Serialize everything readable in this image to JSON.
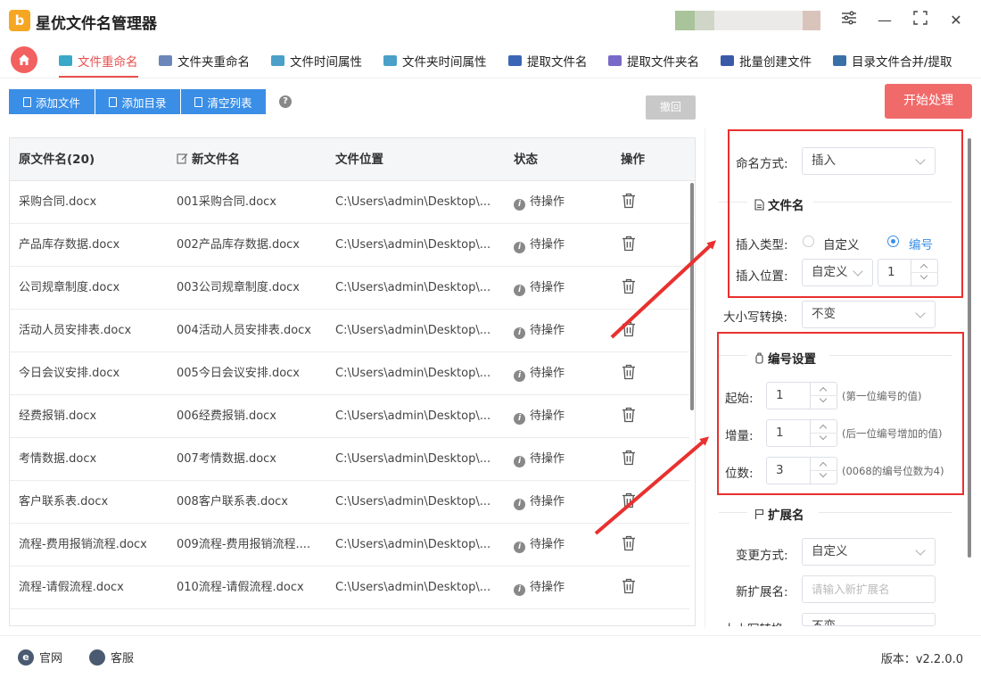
{
  "app": {
    "logo_text": "b",
    "title": "星优文件名管理器"
  },
  "window_controls": {
    "settings_icon": "sliders-icon",
    "minimize": "—",
    "maximize": "⛶",
    "close": "✕"
  },
  "tabs": [
    {
      "label": "文件重命名",
      "active": true,
      "color": "#3aa8c8"
    },
    {
      "label": "文件夹重命名",
      "color": "#6b86b8"
    },
    {
      "label": "文件时间属性",
      "color": "#4aa0c8"
    },
    {
      "label": "文件夹时间属性",
      "color": "#4aa0c8"
    },
    {
      "label": "提取文件名",
      "color": "#3b66b8"
    },
    {
      "label": "提取文件夹名",
      "color": "#7a6ac8"
    },
    {
      "label": "批量创建文件",
      "color": "#3a5aa8"
    },
    {
      "label": "目录文件合并/提取",
      "color": "#3a70a8"
    }
  ],
  "toolbar": {
    "add_file": "添加文件",
    "add_dir": "添加目录",
    "clear_list": "清空列表",
    "help": "?",
    "undo": "撤回",
    "start": "开始处理"
  },
  "table": {
    "headers": {
      "original": "原文件名(20)",
      "new": "新文件名",
      "location": "文件位置",
      "status": "状态",
      "action": "操作"
    },
    "rows": [
      {
        "original": "采购合同.docx",
        "new": "001采购合同.docx",
        "location": "C:\\Users\\admin\\Desktop\\...",
        "status": "待操作"
      },
      {
        "original": "产品库存数据.docx",
        "new": "002产品库存数据.docx",
        "location": "C:\\Users\\admin\\Desktop\\...",
        "status": "待操作"
      },
      {
        "original": "公司规章制度.docx",
        "new": "003公司规章制度.docx",
        "location": "C:\\Users\\admin\\Desktop\\...",
        "status": "待操作"
      },
      {
        "original": "活动人员安排表.docx",
        "new": "004活动人员安排表.docx",
        "location": "C:\\Users\\admin\\Desktop\\...",
        "status": "待操作"
      },
      {
        "original": "今日会议安排.docx",
        "new": "005今日会议安排.docx",
        "location": "C:\\Users\\admin\\Desktop\\...",
        "status": "待操作"
      },
      {
        "original": "经费报销.docx",
        "new": "006经费报销.docx",
        "location": "C:\\Users\\admin\\Desktop\\...",
        "status": "待操作"
      },
      {
        "original": "考情数据.docx",
        "new": "007考情数据.docx",
        "location": "C:\\Users\\admin\\Desktop\\...",
        "status": "待操作"
      },
      {
        "original": "客户联系表.docx",
        "new": "008客户联系表.docx",
        "location": "C:\\Users\\admin\\Desktop\\...",
        "status": "待操作"
      },
      {
        "original": "流程-费用报销流程.docx",
        "new": "009流程-费用报销流程....",
        "location": "C:\\Users\\admin\\Desktop\\...",
        "status": "待操作"
      },
      {
        "original": "流程-请假流程.docx",
        "new": "010流程-请假流程.docx",
        "location": "C:\\Users\\admin\\Desktop\\...",
        "status": "待操作"
      }
    ]
  },
  "settings": {
    "naming_mode_label": "命名方式:",
    "naming_mode_value": "插入",
    "filename_section": "文件名",
    "insert_type_label": "插入类型:",
    "insert_type_options": [
      "自定义",
      "编号"
    ],
    "insert_type_selected": "编号",
    "insert_pos_label": "插入位置:",
    "insert_pos_value": "自定义",
    "insert_pos_number": "1",
    "case_label": "大小写转换:",
    "case_value": "不变",
    "numbering_section": "编号设置",
    "start_label": "起始:",
    "start_value": "1",
    "start_hint": "(第一位编号的值)",
    "step_label": "增量:",
    "step_value": "1",
    "step_hint": "(后一位编号增加的值)",
    "digits_label": "位数:",
    "digits_value": "3",
    "digits_hint": "(0068的编号位数为4)",
    "ext_section": "扩展名",
    "ext_mode_label": "变更方式:",
    "ext_mode_value": "自定义",
    "new_ext_label": "新扩展名:",
    "new_ext_placeholder": "请输入新扩展名",
    "ext_case_label": "大小写转换:",
    "ext_case_value": "不变"
  },
  "footer": {
    "website": "官网",
    "website_icon": "e",
    "support": "客服",
    "version": "版本：v2.2.0.0"
  },
  "colors": {
    "accent": "#3a8ee6",
    "danger": "#f06a6a",
    "annotation": "#e8312f"
  }
}
